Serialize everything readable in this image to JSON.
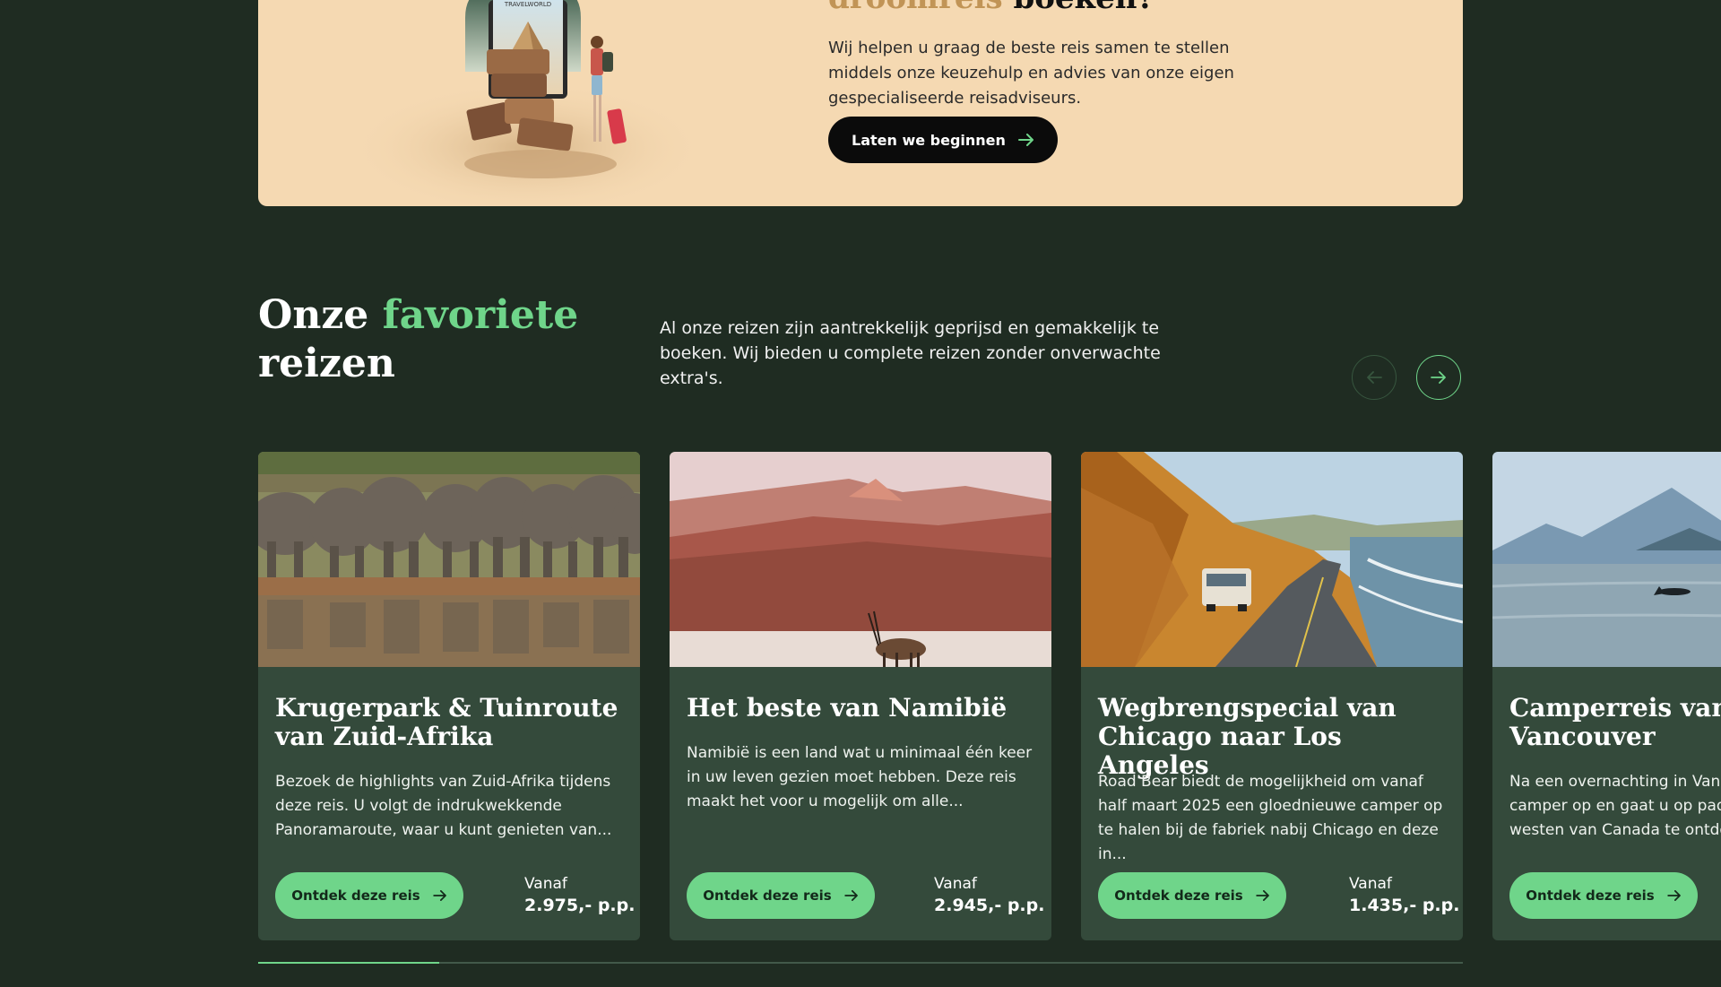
{
  "promo": {
    "headline_accent": "droomreis",
    "headline_rest": "boeken?",
    "text": "Wij helpen u graag de beste reis samen te stellen middels onze keuzehulp en advies van onze eigen gespecialiseerde reisadviseurs.",
    "button_label": "Laten we beginnen",
    "phone_label": "TRAVELWORLD"
  },
  "section": {
    "title_part1": "Onze",
    "title_accent": "favoriete",
    "title_part2": "reizen",
    "intro": "Al onze reizen zijn aantrekkelijk geprijsd en gemakkelijk te boeken. Wij bieden u complete reizen zonder onverwachte extra's."
  },
  "cards": [
    {
      "title": "Krugerpark & Tuinroute van Zuid-Afrika",
      "description": "Bezoek de highlights van Zuid-Afrika tijdens deze reis. U volgt de indrukwekkende Panoramaroute, waar u kunt genieten van...",
      "button_label": "Ontdek deze reis",
      "price_prefix": "Vanaf",
      "price": "2.975,- p.p."
    },
    {
      "title": "Het beste van Namibië",
      "description": "Namibië is een land wat u minimaal één keer in uw leven gezien moet hebben. Deze reis maakt het voor u mogelijk om alle...",
      "button_label": "Ontdek deze reis",
      "price_prefix": "Vanaf",
      "price": "2.945,- p.p."
    },
    {
      "title": "Wegbrengspecial van Chicago naar Los Angeles",
      "description": "Road Bear biedt de mogelijkheid om vanaf half maart 2025 een gloednieuwe camper op te halen bij de fabriek nabij Chicago en deze in...",
      "button_label": "Ontdek deze reis",
      "price_prefix": "Vanaf",
      "price": "1.435,- p.p."
    },
    {
      "title": "Camperreis vanuit Vancouver",
      "description": "Na een overnachting in Vancouver haalt u de camper op en gaat u op pad om het mooie westen van Canada te ontdekken.",
      "button_label": "Ontdek deze reis"
    }
  ],
  "carousel": {
    "progress_fraction": 0.15
  },
  "colors": {
    "background": "#1f2c22",
    "card": "#344a3b",
    "accent_green": "#6fd58a",
    "promo_bg": "#f5d9b2",
    "promo_accent": "#c19456"
  },
  "icons": {
    "prev": "arrow-left-icon",
    "next": "arrow-right-icon",
    "button_arrow": "arrow-right-icon"
  }
}
